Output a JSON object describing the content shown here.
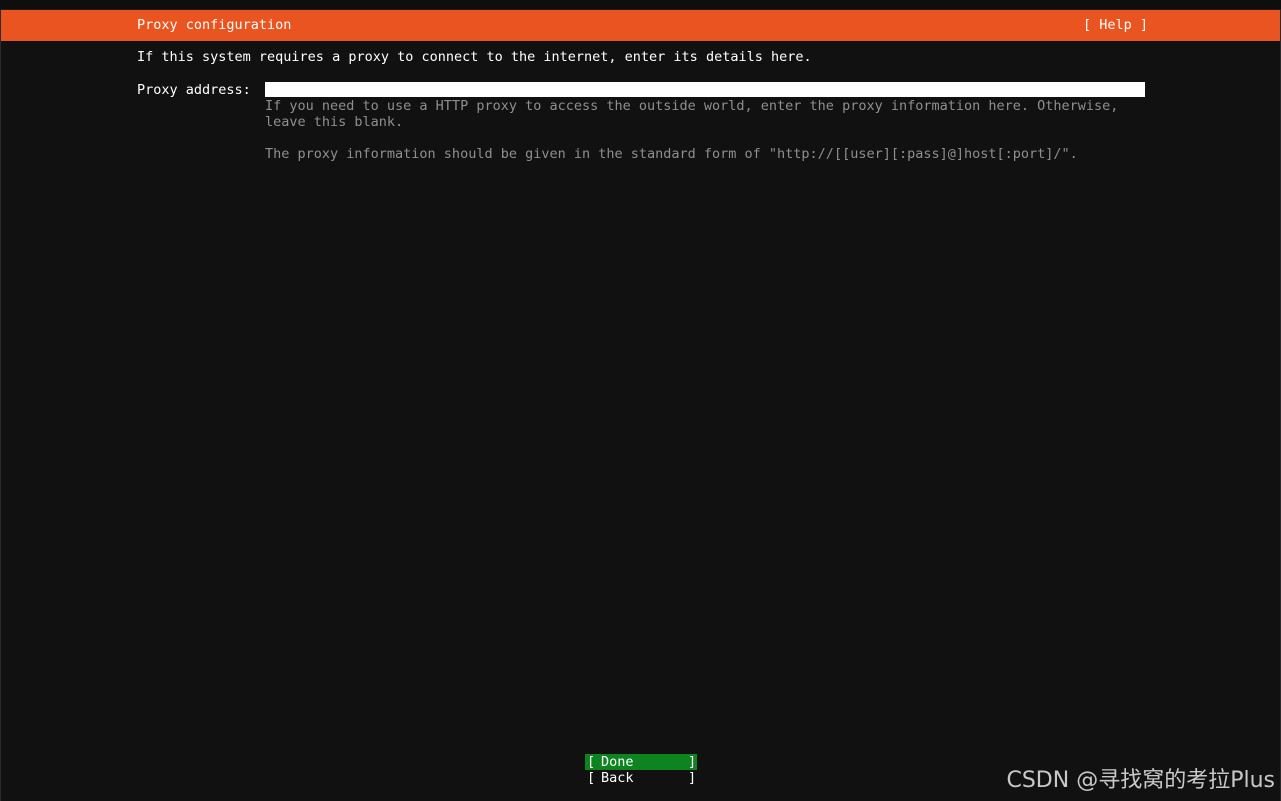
{
  "header": {
    "title": "Proxy configuration",
    "help_label": "[ Help ]",
    "background_color": "#e95420"
  },
  "main": {
    "intro_text": "If this system requires a proxy to connect to the internet, enter its details here.",
    "proxy_field": {
      "label": "Proxy address:",
      "value": "",
      "help_lines": [
        "If you need to use a HTTP proxy to access the outside world, enter the proxy information here. Otherwise,",
        "leave this blank.",
        "The proxy information should be given in the standard form of \"http://[[user][:pass]@]host[:port]/\"."
      ]
    }
  },
  "buttons": {
    "done": {
      "open": "[",
      "label": "Done",
      "close": "]",
      "color": "#0e8420"
    },
    "back": {
      "open": "[",
      "label": "Back",
      "close": "]"
    }
  },
  "watermark": "CSDN @寻找窝的考拉Plus"
}
